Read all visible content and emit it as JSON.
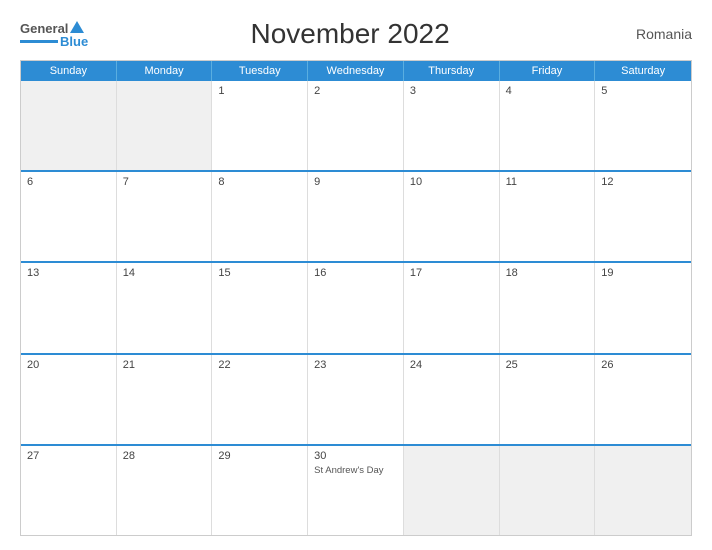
{
  "header": {
    "logo_general": "General",
    "logo_blue": "Blue",
    "title": "November 2022",
    "country": "Romania"
  },
  "days_of_week": [
    "Sunday",
    "Monday",
    "Tuesday",
    "Wednesday",
    "Thursday",
    "Friday",
    "Saturday"
  ],
  "weeks": [
    [
      {
        "number": "",
        "event": "",
        "shaded": true
      },
      {
        "number": "",
        "event": "",
        "shaded": true
      },
      {
        "number": "1",
        "event": "",
        "shaded": false
      },
      {
        "number": "2",
        "event": "",
        "shaded": false
      },
      {
        "number": "3",
        "event": "",
        "shaded": false
      },
      {
        "number": "4",
        "event": "",
        "shaded": false
      },
      {
        "number": "5",
        "event": "",
        "shaded": false
      }
    ],
    [
      {
        "number": "6",
        "event": "",
        "shaded": false
      },
      {
        "number": "7",
        "event": "",
        "shaded": false
      },
      {
        "number": "8",
        "event": "",
        "shaded": false
      },
      {
        "number": "9",
        "event": "",
        "shaded": false
      },
      {
        "number": "10",
        "event": "",
        "shaded": false
      },
      {
        "number": "11",
        "event": "",
        "shaded": false
      },
      {
        "number": "12",
        "event": "",
        "shaded": false
      }
    ],
    [
      {
        "number": "13",
        "event": "",
        "shaded": false
      },
      {
        "number": "14",
        "event": "",
        "shaded": false
      },
      {
        "number": "15",
        "event": "",
        "shaded": false
      },
      {
        "number": "16",
        "event": "",
        "shaded": false
      },
      {
        "number": "17",
        "event": "",
        "shaded": false
      },
      {
        "number": "18",
        "event": "",
        "shaded": false
      },
      {
        "number": "19",
        "event": "",
        "shaded": false
      }
    ],
    [
      {
        "number": "20",
        "event": "",
        "shaded": false
      },
      {
        "number": "21",
        "event": "",
        "shaded": false
      },
      {
        "number": "22",
        "event": "",
        "shaded": false
      },
      {
        "number": "23",
        "event": "",
        "shaded": false
      },
      {
        "number": "24",
        "event": "",
        "shaded": false
      },
      {
        "number": "25",
        "event": "",
        "shaded": false
      },
      {
        "number": "26",
        "event": "",
        "shaded": false
      }
    ],
    [
      {
        "number": "27",
        "event": "",
        "shaded": false
      },
      {
        "number": "28",
        "event": "",
        "shaded": false
      },
      {
        "number": "29",
        "event": "",
        "shaded": false
      },
      {
        "number": "30",
        "event": "St Andrew's Day",
        "shaded": false
      },
      {
        "number": "",
        "event": "",
        "shaded": true
      },
      {
        "number": "",
        "event": "",
        "shaded": true
      },
      {
        "number": "",
        "event": "",
        "shaded": true
      }
    ]
  ]
}
